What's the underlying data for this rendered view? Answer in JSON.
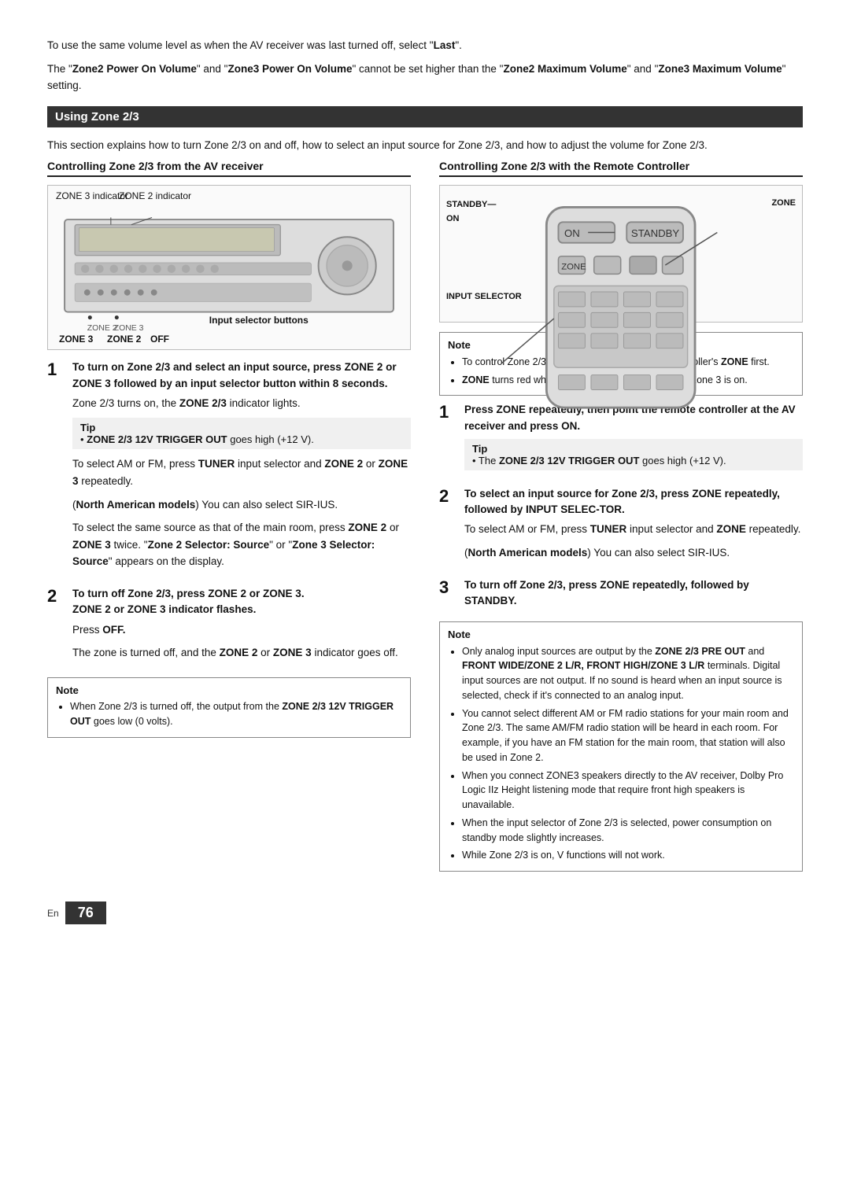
{
  "intro": {
    "line1": "To use the same volume level as when the AV receiver was",
    "line2": "last turned off, select \"",
    "last": "Last",
    "line2end": "\".",
    "zone2power": "Zone2 Power On Volume",
    "zone3power": "Zone3 Power On Volume",
    "zone2max": "Zone2 Maximum Volume",
    "zone3max": "Zone3 Maximum Volume",
    "cannotset": " cannot be set higher than the \"",
    "cannotset2": "\" and \"",
    "cannotset3": "\" setting."
  },
  "using_zone": {
    "heading": "Using Zone 2/3",
    "body": "This section explains how to turn Zone 2/3 on and off, how to select an input source for Zone 2/3, and how to adjust the volume for Zone 2/3."
  },
  "controlling_av": {
    "heading": "Controlling Zone 2/3 from the AV receiver",
    "zone3_indicator": "ZONE 3 indicator",
    "zone2_indicator": "ZONE 2 indicator",
    "input_selector_buttons": "Input selector buttons",
    "zone3": "ZONE 3",
    "zone2": "ZONE 2",
    "off": "OFF"
  },
  "steps_left": [
    {
      "num": "1",
      "title": "To turn on Zone 2/3 and select an input source, press ZONE 2 or ZONE 3 followed by an input selector button within 8 seconds.",
      "body1": "Zone 2/3 turns on, the ",
      "body1b": "ZONE 2/3",
      "body1c": " indicator lights.",
      "tip_label": "Tip",
      "tip1_prefix": "• ",
      "tip1b": "ZONE 2/3 12V TRIGGER OUT",
      "tip1c": " goes high (+12 V).",
      "body2_prefix": "To select AM or FM, press ",
      "body2b": "TUNER",
      "body2c": " input selector and ",
      "body2d": "ZONE 2",
      "body2e": " or ",
      "body2f": "ZONE 3",
      "body2g": " repeatedly.",
      "body3_prefix": "(",
      "body3b": "North American models",
      "body3c": ") You can also select SIR-IUS.",
      "body4": "To select the same source as that of the main room, press ",
      "body4b": "ZONE 2",
      "body4c": " or ",
      "body4d": "ZONE 3",
      "body4e": " twice. \"",
      "body4f": "Zone 2 Selector: Source",
      "body4g": "\" or \"",
      "body4h": "Zone 3 Selector: Source",
      "body4i": "\" appears on the display."
    },
    {
      "num": "2",
      "title1": "To turn off Zone 2/3, press ",
      "title1b": "ZONE 2",
      "title1c": " or ",
      "title1d": "ZONE 3",
      "title1e": ".",
      "title2": "ZONE 2",
      "title2b": " or ",
      "title2c": "ZONE 3",
      "title2d": " indicator flashes.",
      "pressoff": "Press ",
      "pressoffb": "OFF.",
      "body1": "The zone is turned off, and the ",
      "body1b": "ZONE 2",
      "body1c": " or ",
      "body1d": "ZONE 3",
      "body1e": " indicator goes off."
    }
  ],
  "note_bottom_left": {
    "label": "Note",
    "text": "• When Zone 2/3 is turned off, the output from the ",
    "textb": "ZONE 2/3 12V TRIGGER OUT",
    "textc": " goes low (0 volts)."
  },
  "controlling_remote": {
    "heading": "Controlling Zone 2/3 with the Remote Controller",
    "standby": "STANDBY",
    "on": "ON",
    "zone": "ZONE",
    "input_selector": "INPUT SELECTOR"
  },
  "note_right1": {
    "label": "Note",
    "items": [
      "To control Zone 2/3, you must press the remote controller's ZONE first.",
      "ZONE turns red while Zone 2 is on, and green while Zone 3 is on."
    ]
  },
  "steps_right": [
    {
      "num": "1",
      "title": "Press ZONE repeatedly, then point the remote controller at the AV receiver and press ON.",
      "tip_label": "Tip",
      "tip1": "• The ",
      "tip1b": "ZONE 2/3 12V TRIGGER OUT",
      "tip1c": " goes high (+12 V)."
    },
    {
      "num": "2",
      "title1": "To select an input source for Zone 2/3, press ",
      "title1b": "ZONE",
      "title1c": " repeatedly, followed by ",
      "title1d": "INPUT SELEC-TOR.",
      "body1": "To select AM or FM, press ",
      "body1b": "TUNER",
      "body1c": " input selector and ",
      "body1d": "ZONE",
      "body1e": " repeatedly.",
      "body2_prefix": "(",
      "body2b": "North American models",
      "body2c": ") You can also select SIR-IUS."
    },
    {
      "num": "3",
      "title1": "To turn off Zone 2/3, press ",
      "title1b": "ZONE",
      "title1c": " repeatedly, followed by ",
      "title1d": "STANDBY."
    }
  ],
  "note_right2": {
    "label": "Note",
    "items": [
      "Only analog input sources are output by the ZONE 2/3 PRE OUT and FRONT WIDE/ZONE 2 L/R, FRONT HIGH/ZONE 3 L/R terminals. Digital input sources are not output. If no sound is heard when an input source is selected, check if it's connected to an analog input.",
      "You cannot select different AM or FM radio stations for your main room and Zone 2/3. The same AM/FM radio station will be heard in each room. For example, if you have an FM station for the main room, that station will also be used in Zone 2.",
      "When you connect ZONE3 speakers directly to the AV receiver, Dolby Pro Logic IIz Height listening mode that require front high speakers is unavailable.",
      "When the input selector of Zone 2/3 is selected, power consumption on standby mode slightly increases.",
      "While Zone 2/3 is on, V functions will not work."
    ]
  },
  "footer": {
    "en": "En",
    "page": "76"
  }
}
